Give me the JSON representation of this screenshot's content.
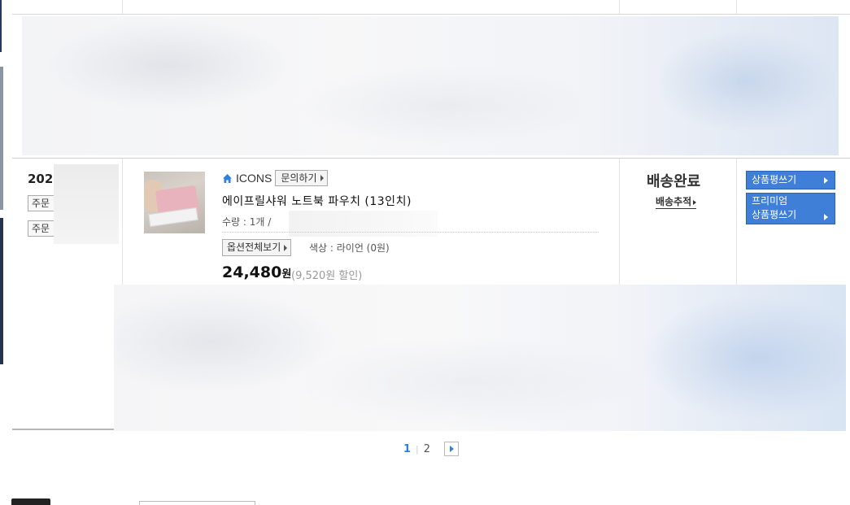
{
  "order": {
    "date_partial": "202",
    "buttons": [
      "주문",
      "주문"
    ]
  },
  "product": {
    "brand": "ICONS",
    "ask_label": "문의하기",
    "name": "에이프릴샤워 노트북 파우치 (13인치)",
    "qty_label": "수량 : 1개 /",
    "option_button": "옵션전체보기",
    "option_text": "색상 : 라이언 (0원)",
    "price": "24,480",
    "price_unit": "원",
    "discount": "(9,520원 할인)"
  },
  "delivery": {
    "status": "배송완료",
    "tracking_label": "배송추적"
  },
  "review": {
    "write_label": "상품평쓰기",
    "premium_line1": "프리미엄",
    "premium_line2": "상품평쓰기"
  },
  "pagination": {
    "current": "1",
    "other": "2"
  },
  "colors": {
    "accent_blue": "#3f7fd8",
    "page_current": "#2f7fe0"
  },
  "icons": [
    "home-icon",
    "caret-right-icon",
    "chevron-right-icon"
  ]
}
